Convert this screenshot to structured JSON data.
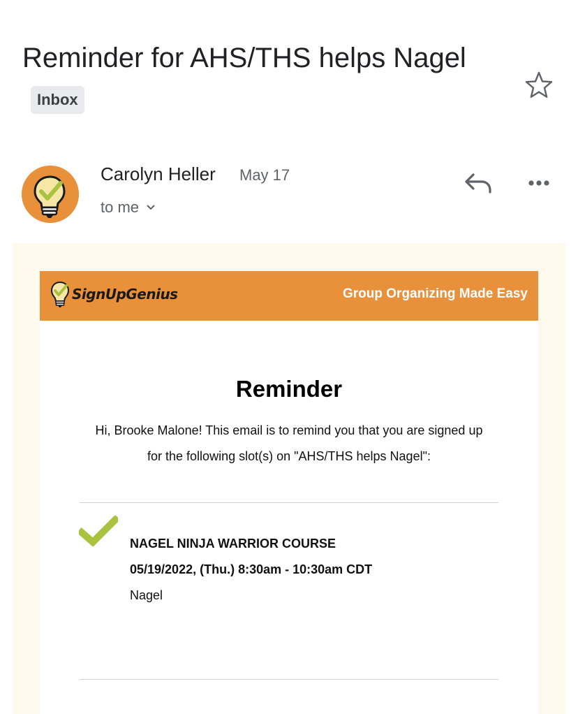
{
  "email": {
    "subject": "Reminder for AHS/THS helps Nagel",
    "label": "Inbox",
    "sender": "Carolyn Heller",
    "date": "May 17",
    "recipient": "to me"
  },
  "icons": {
    "star": "star-outline-icon",
    "reply": "reply-icon",
    "more": "more-horizontal-icon",
    "chevron": "chevron-down-icon"
  },
  "banner": {
    "logo_text": "SignUpGenius",
    "tagline": "Group Organizing Made Easy"
  },
  "body": {
    "heading": "Reminder",
    "intro": "Hi, Brooke Malone! This email is to remind you that you are signed up for the following slot(s) on \"AHS/THS helps Nagel\":"
  },
  "slot": {
    "title": "NAGEL NINJA WARRIOR COURSE",
    "datetime": "05/19/2022, (Thu.) 8:30am - 10:30am CDT",
    "location": "Nagel"
  },
  "colors": {
    "brand_orange": "#e8913a",
    "check_green": "#a9c23f",
    "email_background": "#fdf9ec"
  }
}
